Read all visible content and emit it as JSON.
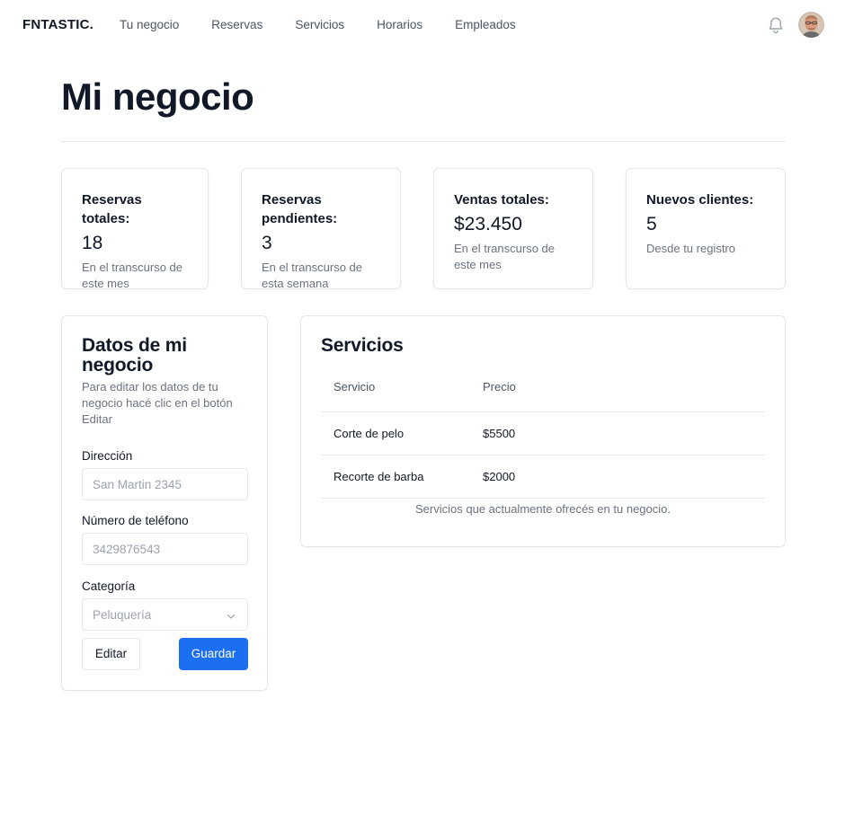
{
  "brand": "FNTASTIC.",
  "nav": {
    "items": [
      "Tu negocio",
      "Reservas",
      "Servicios",
      "Horarios",
      "Empleados"
    ]
  },
  "header": {
    "notifications_icon": "bell-icon",
    "avatar_icon": "user-avatar"
  },
  "page": {
    "title": "Mi negocio"
  },
  "stats": [
    {
      "label": "Reservas totales:",
      "value": "18",
      "desc": "En el transcurso de este mes"
    },
    {
      "label": "Reservas pendientes:",
      "value": "3",
      "desc": "En el transcurso de esta semana"
    },
    {
      "label": "Ventas totales:",
      "value": "$23.450",
      "desc": "En el transcurso de este mes"
    },
    {
      "label": "Nuevos clientes:",
      "value": "5",
      "desc": "Desde tu registro"
    }
  ],
  "business_form": {
    "title": "Datos de mi negocio",
    "description": "Para editar los datos de tu negocio hacé clic en el botón Editar",
    "address_label": "Dirección",
    "address_placeholder": "San Martin 2345",
    "phone_label": "Número de teléfono",
    "phone_placeholder": "3429876543",
    "category_label": "Categoría",
    "category_value": "Peluquería",
    "edit_label": "Editar",
    "save_label": "Guardar"
  },
  "services": {
    "title": "Servicios",
    "columns": [
      "Servicio",
      "Precio"
    ],
    "rows": [
      {
        "service": "Corte de pelo",
        "price": "$5500"
      },
      {
        "service": "Recorte de barba",
        "price": "$2000"
      }
    ],
    "caption": "Servicios que actualmente ofrecés en tu negocio."
  },
  "colors": {
    "primary": "#1d6ff2",
    "text": "#111827",
    "muted": "#6b7280",
    "border": "#e5e7eb"
  }
}
